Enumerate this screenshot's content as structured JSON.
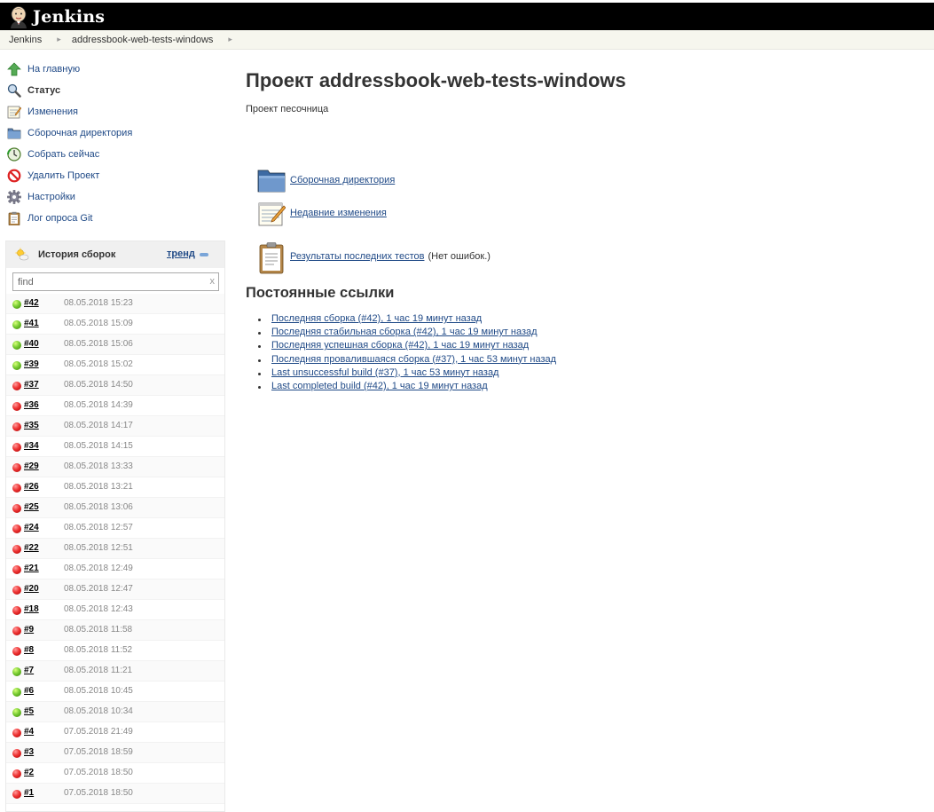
{
  "header": {
    "logo_text": "Jenkins"
  },
  "breadcrumb": {
    "items": [
      "Jenkins",
      "addressbook-web-tests-windows"
    ],
    "separator": "▸"
  },
  "tasks": [
    {
      "label": "На главную",
      "icon": "up-arrow-icon"
    },
    {
      "label": "Статус",
      "icon": "magnifier-icon",
      "current": true
    },
    {
      "label": "Изменения",
      "icon": "notepad-icon"
    },
    {
      "label": "Сборочная директория",
      "icon": "folder-icon"
    },
    {
      "label": "Собрать сейчас",
      "icon": "clock-icon"
    },
    {
      "label": "Удалить Проект",
      "icon": "no-entry-icon"
    },
    {
      "label": "Настройки",
      "icon": "gear-icon"
    },
    {
      "label": "Лог опроса Git",
      "icon": "clipboard-icon"
    }
  ],
  "history": {
    "title": "История сборок",
    "trend_label": "тренд",
    "search_placeholder": "find",
    "clear_label": "x",
    "builds": [
      {
        "number": "#42",
        "date": "08.05.2018 15:23",
        "status": "blue"
      },
      {
        "number": "#41",
        "date": "08.05.2018 15:09",
        "status": "blue"
      },
      {
        "number": "#40",
        "date": "08.05.2018 15:06",
        "status": "blue"
      },
      {
        "number": "#39",
        "date": "08.05.2018 15:02",
        "status": "blue"
      },
      {
        "number": "#37",
        "date": "08.05.2018 14:50",
        "status": "red"
      },
      {
        "number": "#36",
        "date": "08.05.2018 14:39",
        "status": "red"
      },
      {
        "number": "#35",
        "date": "08.05.2018 14:17",
        "status": "red"
      },
      {
        "number": "#34",
        "date": "08.05.2018 14:15",
        "status": "red"
      },
      {
        "number": "#29",
        "date": "08.05.2018 13:33",
        "status": "red"
      },
      {
        "number": "#26",
        "date": "08.05.2018 13:21",
        "status": "red"
      },
      {
        "number": "#25",
        "date": "08.05.2018 13:06",
        "status": "red"
      },
      {
        "number": "#24",
        "date": "08.05.2018 12:57",
        "status": "red"
      },
      {
        "number": "#22",
        "date": "08.05.2018 12:51",
        "status": "red"
      },
      {
        "number": "#21",
        "date": "08.05.2018 12:49",
        "status": "red"
      },
      {
        "number": "#20",
        "date": "08.05.2018 12:47",
        "status": "red"
      },
      {
        "number": "#18",
        "date": "08.05.2018 12:43",
        "status": "red"
      },
      {
        "number": "#9",
        "date": "08.05.2018 11:58",
        "status": "red"
      },
      {
        "number": "#8",
        "date": "08.05.2018 11:52",
        "status": "red"
      },
      {
        "number": "#7",
        "date": "08.05.2018 11:21",
        "status": "blue"
      },
      {
        "number": "#6",
        "date": "08.05.2018 10:45",
        "status": "blue"
      },
      {
        "number": "#5",
        "date": "08.05.2018 10:34",
        "status": "blue"
      },
      {
        "number": "#4",
        "date": "07.05.2018 21:49",
        "status": "red"
      },
      {
        "number": "#3",
        "date": "07.05.2018 18:59",
        "status": "red"
      },
      {
        "number": "#2",
        "date": "07.05.2018 18:50",
        "status": "red"
      },
      {
        "number": "#1",
        "date": "07.05.2018 18:50",
        "status": "red"
      }
    ]
  },
  "main": {
    "title": "Проект addressbook-web-tests-windows",
    "description": "Проект песочница",
    "links": {
      "workspace": "Сборочная директория",
      "changes": "Недавние изменения",
      "test_results": "Результаты последних тестов",
      "test_results_note": "(Нет ошибок.)"
    },
    "permalinks_title": "Постоянные ссылки",
    "permalinks": [
      "Последняя сборка (#42), 1 час 19 минут назад",
      "Последняя стабильная сборка (#42), 1 час 19 минут назад",
      "Последняя успешная сборка (#42), 1 час 19 минут назад",
      "Последняя провалившаяся сборка (#37), 1 час 53 минут назад",
      "Last unsuccessful build (#37), 1 час 53 минут назад",
      "Last completed build (#42), 1 час 19 минут назад"
    ]
  },
  "colors": {
    "link": "#204a87",
    "header_bg": "#000000",
    "breadcrumb_bg": "#f6f6ee",
    "success": "#77cc33",
    "failure": "#ee3333"
  }
}
